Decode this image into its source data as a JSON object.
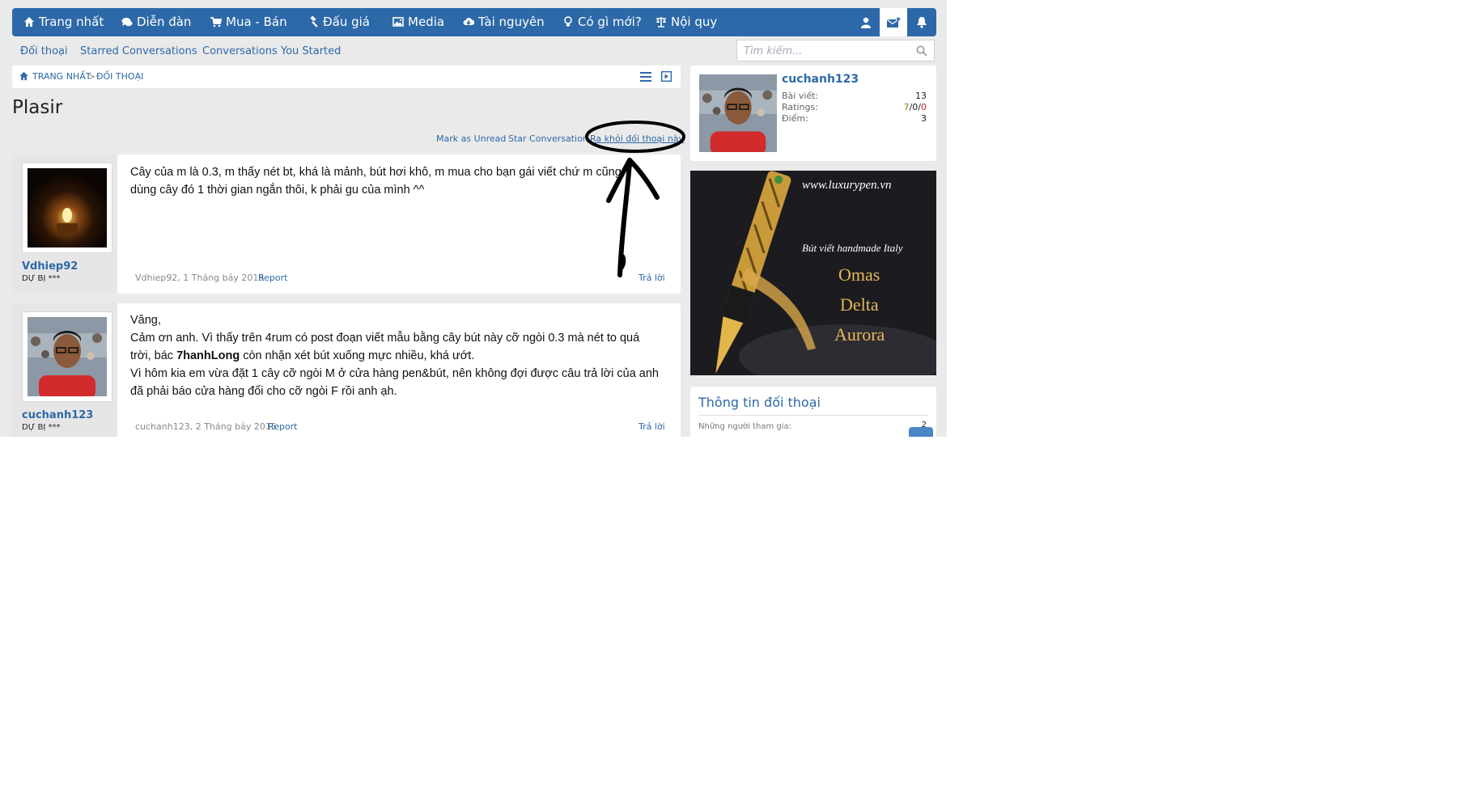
{
  "nav": {
    "items": [
      {
        "label": "Trang nhất",
        "icon": "home-icon"
      },
      {
        "label": "Diễn đàn",
        "icon": "chat-bubbles-icon"
      },
      {
        "label": "Mua - Bán",
        "icon": "cart-icon"
      },
      {
        "label": "Đấu giá",
        "icon": "gavel-icon"
      },
      {
        "label": "Media",
        "icon": "image-icon"
      },
      {
        "label": "Tài nguyên",
        "icon": "cloud-download-icon"
      },
      {
        "label": "Có gì mới?",
        "icon": "lightbulb-icon"
      },
      {
        "label": "Nội quy",
        "icon": "scales-icon"
      }
    ],
    "right_icons": [
      "user-icon",
      "envelope-icon",
      "bell-icon"
    ],
    "colors": {
      "bar": "#2d69a8",
      "active_tab": "#ffffff"
    }
  },
  "subnav": {
    "tabs": [
      "Đối thoại",
      "Starred Conversations",
      "Conversations You Started"
    ]
  },
  "search": {
    "placeholder": "Tìm kiếm..."
  },
  "breadcrumb": {
    "items": [
      "TRANG NHẤT",
      "ĐỐI THOẠI"
    ],
    "separator": ">"
  },
  "page": {
    "title": "Plasir",
    "actions": [
      "Mark as Unread",
      "Star Conversation",
      "Ra khỏi đối thoại này"
    ]
  },
  "posts": [
    {
      "username": "Vdhiep92",
      "user_title": "DỰ BỊ ***",
      "lines": [
        "Cây của m là 0.3, m thấy nét bt, khá là mảnh, bút hơi khô, m mua cho bạn gái viết chứ m cũng",
        "dùng cây đó 1 thời gian ngắn thôi, k phải gu của mình ^^"
      ],
      "meta": "Vdhiep92, 1 Tháng bảy 2015",
      "report": "Report",
      "reply": "Trả lời"
    },
    {
      "username": "cuchanh123",
      "user_title": "DỰ BỊ ***",
      "greeting": "Vâng,",
      "line2": "Cảm ơn anh. Vì thấy trên 4rum có post đoạn viết mẫu bằng cây bút này cỡ ngòi 0.3 mà nét to quá",
      "line3_pre": "trời, bác ",
      "line3_bold": "7hanhLong",
      "line3_post": " còn nhận xét bút xuống mực nhiều, khá ướt.",
      "line4": "Vì hôm kia em vừa đặt 1 cây cỡ ngòi M ở cửa hàng pen&bút, nên không đợi được câu trả lời của anh",
      "line5": "đã phải báo cửa hàng đổi cho cỡ ngòi F rồi anh ạh.",
      "meta": "cuchanh123, 2 Tháng bảy 2015",
      "report": "Report",
      "reply": "Trả lời"
    }
  ],
  "sidebar": {
    "profile": {
      "username": "cuchanh123",
      "stats": [
        {
          "label": "Bài viết:",
          "value": "13"
        },
        {
          "label": "Ratings:",
          "value_pos": "7",
          "value_neu": "0",
          "value_neg": "0",
          "sep": "/"
        },
        {
          "label": "Điểm:",
          "value": "3"
        }
      ]
    },
    "ad": {
      "url": "www.luxurypen.vn",
      "tagline": "Bút viết handmade Italy",
      "brands": [
        "Omas",
        "Delta",
        "Aurora"
      ]
    },
    "conversation_info": {
      "title": "Thông tin đối thoại",
      "participants_label": "Những người tham gia:",
      "participants_count": "2"
    }
  }
}
